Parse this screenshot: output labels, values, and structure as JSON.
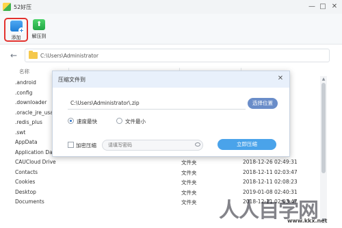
{
  "app": {
    "title": "52好压"
  },
  "window": {
    "min_glyph": "—",
    "max_glyph": "□",
    "close_glyph": "✕"
  },
  "toolbar": {
    "add_label": "添加",
    "extract_label": "解压到"
  },
  "address": {
    "path": "C:\\Users\\Administrator"
  },
  "list": {
    "name_header": "名称",
    "rows": [
      {
        "name": ".android",
        "type": "",
        "date": ""
      },
      {
        "name": ".config",
        "type": "",
        "date": ""
      },
      {
        "name": ".downloader",
        "type": "",
        "date": ""
      },
      {
        "name": ".oracle_jre_usa",
        "type": "",
        "date": ""
      },
      {
        "name": ".redis_plus",
        "type": "",
        "date": ""
      },
      {
        "name": ".swt",
        "type": "",
        "date": ""
      },
      {
        "name": "AppData",
        "type": "",
        "date": ""
      },
      {
        "name": "Application Da",
        "type": "",
        "date": ""
      },
      {
        "name": "CAUCloud Drive",
        "type": "文件夹",
        "date": "2018-12-26 02:49:31"
      },
      {
        "name": "Contacts",
        "type": "文件夹",
        "date": "2018-12-11 02:03:47"
      },
      {
        "name": "Cookies",
        "type": "文件夹",
        "date": "2018-12-11 02:08:23"
      },
      {
        "name": "Desktop",
        "type": "文件夹",
        "date": "2019-01-08 02:40:31"
      },
      {
        "name": "Documents",
        "type": "文件夹",
        "date": "2018-12-11 02:03:47"
      }
    ]
  },
  "dialog": {
    "title": "压缩文件到",
    "path_value": "C:\\Users\\Administrator\\.zip",
    "choose_label": "选择位置",
    "option_fast": "速度最快",
    "option_small": "文件最小",
    "encrypt_label": "加密压缩",
    "password_placeholder": "请填写密码",
    "compress_label": "立即压缩"
  },
  "watermark": {
    "text": "人人自学网",
    "url": "www.kkx.net"
  }
}
